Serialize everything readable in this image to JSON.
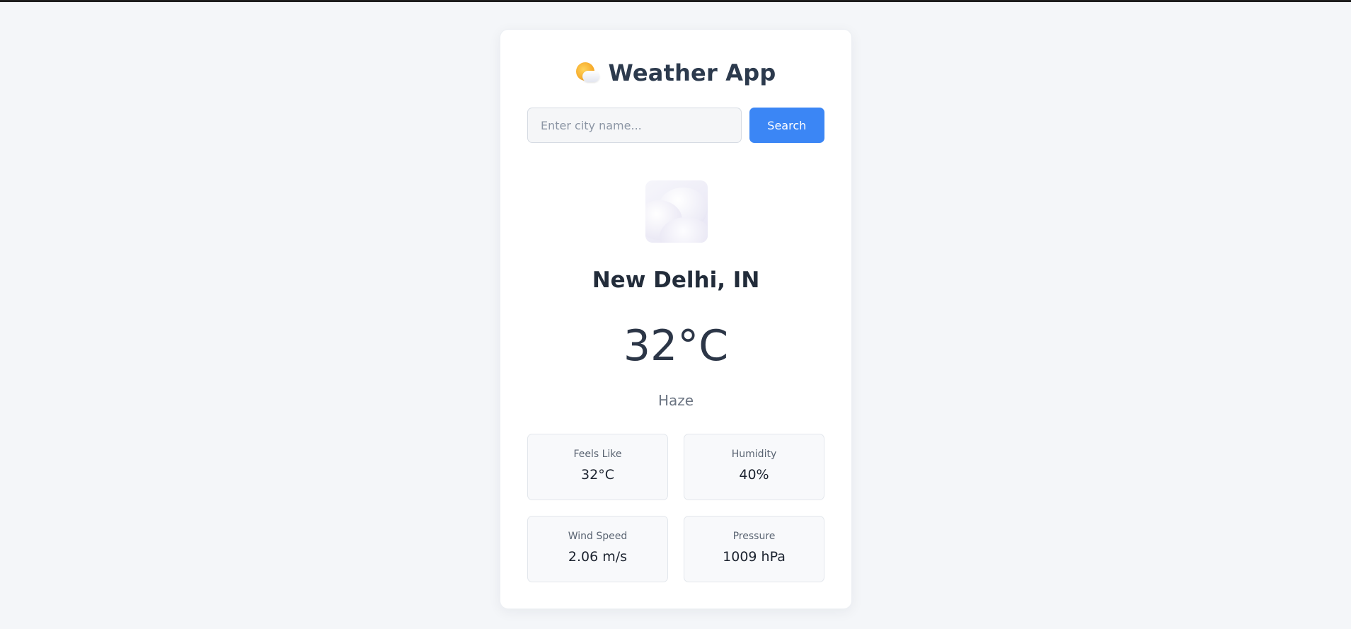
{
  "app": {
    "title": "Weather App",
    "title_icon": "sun-behind-cloud-icon"
  },
  "search": {
    "placeholder": "Enter city name...",
    "value": "",
    "button_label": "Search"
  },
  "weather": {
    "icon": "cloud-icon",
    "city": "New Delhi, IN",
    "temperature": "32°C",
    "description": "Haze"
  },
  "stats": [
    {
      "label": "Feels Like",
      "value": "32°C"
    },
    {
      "label": "Humidity",
      "value": "40%"
    },
    {
      "label": "Wind Speed",
      "value": "2.06 m/s"
    },
    {
      "label": "Pressure",
      "value": "1009 hPa"
    }
  ],
  "colors": {
    "accent": "#3b86f5",
    "background": "#f4f6f9",
    "card": "#ffffff",
    "title_text": "#2c3a4d"
  }
}
